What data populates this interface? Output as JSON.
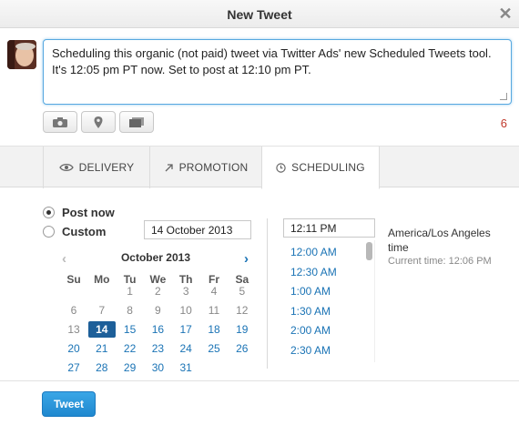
{
  "window": {
    "title": "New Tweet",
    "close_label": "✕"
  },
  "compose": {
    "text": "Scheduling this organic (not paid) tweet via Twitter Ads' new Scheduled Tweets tool. It's 12:05 pm PT now. Set to post at 12:10 pm PT.",
    "char_count": "6"
  },
  "media_buttons": [
    "camera-icon",
    "location-icon",
    "cards-icon"
  ],
  "tabs": [
    {
      "label": "DELIVERY",
      "icon": "eye-icon"
    },
    {
      "label": "PROMOTION",
      "icon": "arrow-up-right-icon"
    },
    {
      "label": "SCHEDULING",
      "icon": "clock-icon",
      "active": true
    }
  ],
  "schedule": {
    "post_now_label": "Post now",
    "custom_label": "Custom",
    "selected_option": "Post now",
    "date_value": "14 October 2013",
    "calendar": {
      "month_label": "October 2013",
      "weekdays": [
        "Su",
        "Mo",
        "Tu",
        "We",
        "Th",
        "Fr",
        "Sa"
      ],
      "weeks": [
        [
          "",
          "",
          "1",
          "2",
          "3",
          "4",
          "5"
        ],
        [
          "6",
          "7",
          "8",
          "9",
          "10",
          "11",
          "12"
        ],
        [
          "13",
          "14",
          "15",
          "16",
          "17",
          "18",
          "19"
        ],
        [
          "20",
          "21",
          "22",
          "23",
          "24",
          "25",
          "26"
        ],
        [
          "27",
          "28",
          "29",
          "30",
          "31",
          "",
          ""
        ]
      ],
      "selected_day": "14"
    },
    "time_value": "12:11 PM",
    "time_options": [
      "12:00 AM",
      "12:30 AM",
      "1:00 AM",
      "1:30 AM",
      "2:00 AM",
      "2:30 AM"
    ],
    "timezone": "America/Los Angeles time",
    "current_time": "Current time: 12:06 PM"
  },
  "footer": {
    "tweet_label": "Tweet"
  },
  "colors": {
    "accent": "#1a73b5",
    "selected_day": "#1d5f99",
    "counter": "#c0392b",
    "tweet_button": "#2a96db"
  }
}
